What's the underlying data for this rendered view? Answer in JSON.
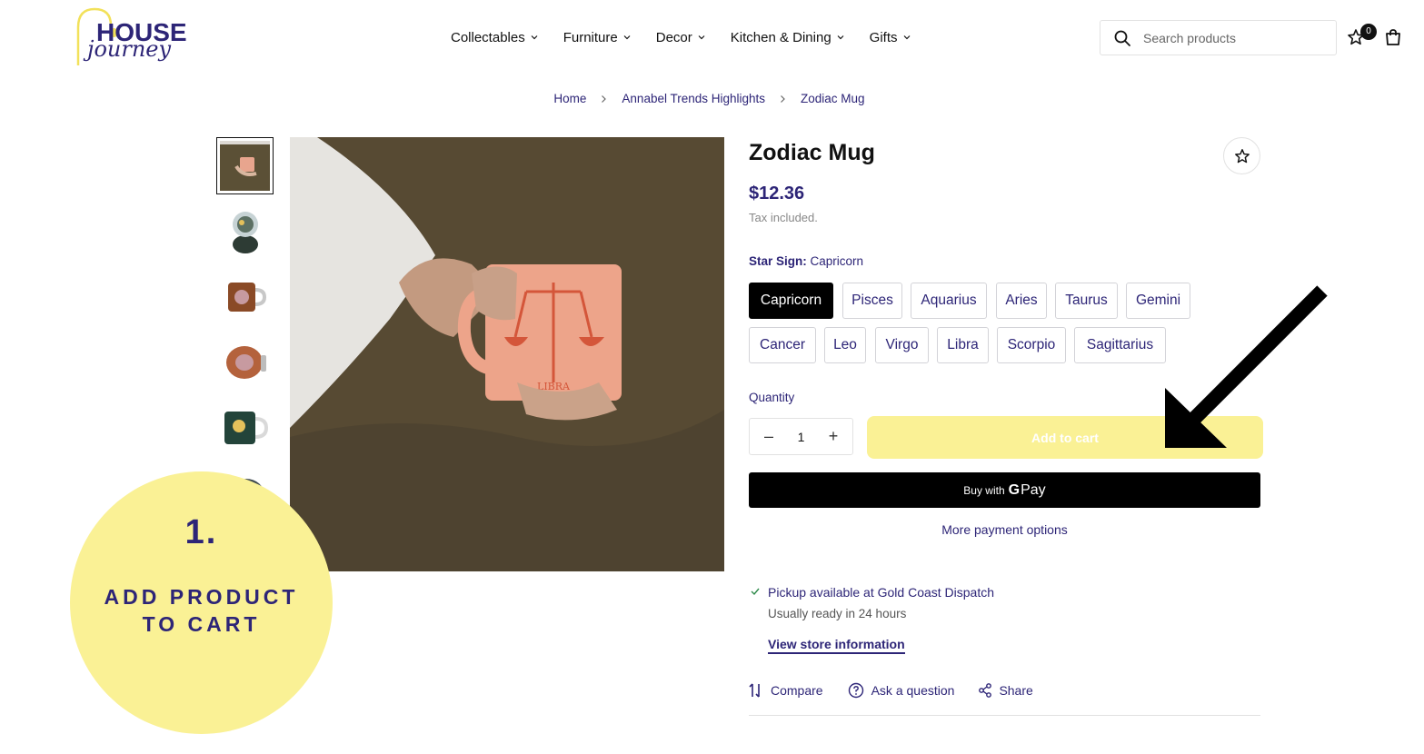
{
  "brand": {
    "line1": "HOUSE",
    "line2": "journey"
  },
  "nav": [
    {
      "label": "Collectables"
    },
    {
      "label": "Furniture"
    },
    {
      "label": "Decor"
    },
    {
      "label": "Kitchen & Dining"
    },
    {
      "label": "Gifts"
    }
  ],
  "search": {
    "placeholder": "Search products"
  },
  "wishlist": {
    "count": "0"
  },
  "breadcrumb": [
    "Home",
    "Annabel Trends Highlights",
    "Zodiac Mug"
  ],
  "product": {
    "title": "Zodiac Mug",
    "price": "$12.36",
    "tax": "Tax included.",
    "option_name": "Star Sign:",
    "option_value": "Capricorn",
    "variants": [
      "Capricorn",
      "Pisces",
      "Aquarius",
      "Aries",
      "Taurus",
      "Gemini",
      "Cancer",
      "Leo",
      "Virgo",
      "Libra",
      "Scorpio",
      "Sagittarius"
    ],
    "selected_variant": "Capricorn",
    "quantity_label": "Quantity",
    "quantity": "1",
    "qty_minus": "–",
    "qty_plus": "+",
    "add_to_cart": "Add to cart",
    "buy_with": "Buy with",
    "gpay_g": "G",
    "gpay_pay": "Pay",
    "more_payment": "More payment options",
    "pickup": "Pickup available at Gold Coast Dispatch",
    "ready": "Usually ready in 24 hours",
    "store_info": "View store information",
    "actions": {
      "compare": "Compare",
      "ask": "Ask a question",
      "share": "Share"
    },
    "mug_text": "LIBRA"
  },
  "annotation": {
    "number": "1.",
    "line1": "ADD PRODUCT",
    "line2": "TO CART"
  },
  "colors": {
    "brand": "#2d2577",
    "accent_yellow": "#faf195",
    "black": "#000000"
  }
}
